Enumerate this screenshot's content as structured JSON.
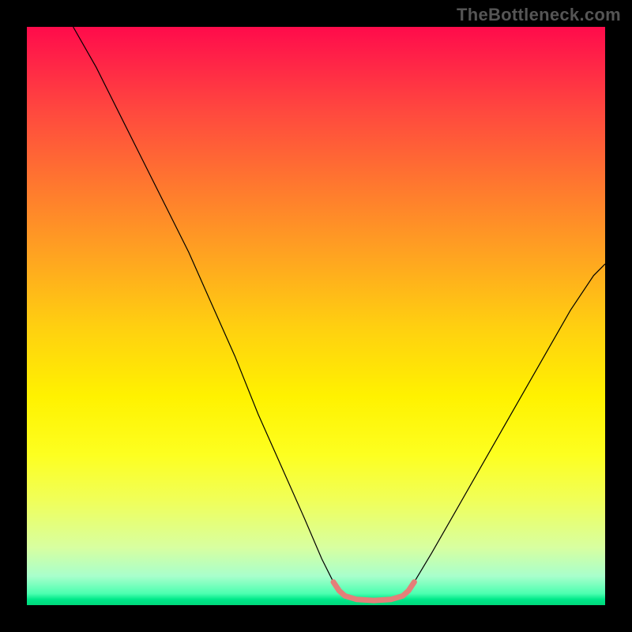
{
  "watermark": "TheBottleneck.com",
  "chart_data": {
    "type": "line",
    "title": "",
    "xlabel": "",
    "ylabel": "",
    "xlim": [
      0,
      100
    ],
    "ylim": [
      0,
      100
    ],
    "grid": false,
    "legend": false,
    "background_gradient": {
      "type": "vertical",
      "stops": [
        {
          "pos": 0,
          "color": "#ff0b4b"
        },
        {
          "pos": 28,
          "color": "#ff7a2e"
        },
        {
          "pos": 52,
          "color": "#ffd010"
        },
        {
          "pos": 74,
          "color": "#fdff20"
        },
        {
          "pos": 95,
          "color": "#a8ffcc"
        },
        {
          "pos": 100,
          "color": "#00d87a"
        }
      ]
    },
    "series": [
      {
        "name": "left-arm",
        "stroke": "#000000",
        "stroke_width": 1.2,
        "points_xy": [
          [
            8,
            100
          ],
          [
            12,
            93
          ],
          [
            16,
            85
          ],
          [
            20,
            77
          ],
          [
            24,
            69
          ],
          [
            28,
            61
          ],
          [
            32,
            52
          ],
          [
            36,
            43
          ],
          [
            40,
            33
          ],
          [
            44,
            24
          ],
          [
            48,
            15
          ],
          [
            51,
            8
          ],
          [
            53,
            4
          ]
        ]
      },
      {
        "name": "right-arm",
        "stroke": "#000000",
        "stroke_width": 1.2,
        "points_xy": [
          [
            67,
            4
          ],
          [
            70,
            9
          ],
          [
            74,
            16
          ],
          [
            78,
            23
          ],
          [
            82,
            30
          ],
          [
            86,
            37
          ],
          [
            90,
            44
          ],
          [
            94,
            51
          ],
          [
            98,
            57
          ],
          [
            100,
            59
          ]
        ]
      },
      {
        "name": "valley-marker",
        "stroke": "#e47f79",
        "stroke_width": 7,
        "linecap": "round",
        "points_xy": [
          [
            53,
            4
          ],
          [
            54,
            2.5
          ],
          [
            55,
            1.6
          ],
          [
            57,
            1.0
          ],
          [
            60,
            0.8
          ],
          [
            63,
            1.0
          ],
          [
            65,
            1.6
          ],
          [
            66,
            2.5
          ],
          [
            67,
            4
          ]
        ]
      }
    ],
    "annotations": []
  }
}
